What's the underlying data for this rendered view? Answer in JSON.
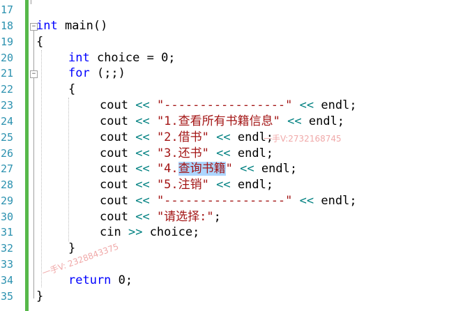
{
  "editor": {
    "line_numbers": [
      "17",
      "18",
      "19",
      "20",
      "21",
      "22",
      "23",
      "24",
      "25",
      "26",
      "27",
      "28",
      "29",
      "30",
      "31",
      "32",
      "33",
      "34",
      "35"
    ],
    "code": {
      "l18_kw": "int",
      "l18_rest": " main()",
      "l19": "{",
      "l20_kw": "int",
      "l20_rest": " choice = 0;",
      "l21_kw": "for",
      "l21_rest": " (;;)",
      "l22": "{",
      "cout": "cout",
      "op_out": "<<",
      "endl_tail": " endl;",
      "l23_str": "\"-----------------\"",
      "l24_str": "\"1.查看所有书籍信息\"",
      "l25_str": "\"2.借书\"",
      "l26_str": "\"3.还书\"",
      "l27_str_a": "\"4.",
      "l27_str_sel": "查询书籍",
      "l27_str_b": "\"",
      "l28_str": "\"5.注销\"",
      "l29_str": "\"-----------------\"",
      "l30_str": "\"请选择:\"",
      "l30_tail": ";",
      "l31_cin": "cin",
      "op_in": ">>",
      "l31_tail": " choice;",
      "l32": "}",
      "l34_kw": "return",
      "l34_rest": " 0;",
      "l35": "}"
    }
  },
  "watermarks": {
    "wm1": "一手V:2732168745",
    "wm2": "一手V: 2328843375"
  },
  "colors": {
    "keyword": "#0000ff",
    "string": "#a31515",
    "operator": "#008080",
    "line_number": "#2b91af",
    "change_bar": "#57b84a",
    "selection": "#add6ff"
  }
}
